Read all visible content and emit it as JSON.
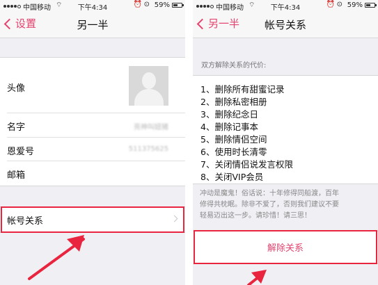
{
  "status_bar": {
    "carrier": "中国移动",
    "time": "下午4:34",
    "battery_percent": "59%",
    "battery_level": 0.59,
    "icons": [
      "wifi-icon",
      "alarm-icon",
      "lock-rotation-icon",
      "battery-icon"
    ]
  },
  "left": {
    "nav": {
      "back_label": "设置",
      "title": "另一半"
    },
    "rows": {
      "avatar_label": "头像",
      "name_label": "名字",
      "name_value": "亮神叫妞猪",
      "love_id_label": "恩爱号",
      "love_id_value": "511375625",
      "email_label": "邮箱",
      "account_label": "帐号关系"
    }
  },
  "right": {
    "nav": {
      "back_label": "另一半",
      "title": "帐号关系"
    },
    "cost_header": "双方解除关系的代价:",
    "consequences": [
      "1、删除所有甜蜜记录",
      "2、删除私密相册",
      "3、删除纪念日",
      "4、删除记事本",
      "5、删除情侣空间",
      "6、使用时长清零",
      "7、关闭情侣说发言权限",
      "8、关闭VIP会员"
    ],
    "warning_lines": [
      "冲动是魔鬼！俗话说：十年修得同船渡，百年",
      "修得共枕眠。除非不爱了，否则我们建议不要",
      "轻易迈出这一步。请珍惜！请三思！"
    ],
    "unbind_button": "解除关系"
  },
  "colors": {
    "accent": "#e4436f",
    "highlight": "#e8243f",
    "background": "#efeff4"
  }
}
